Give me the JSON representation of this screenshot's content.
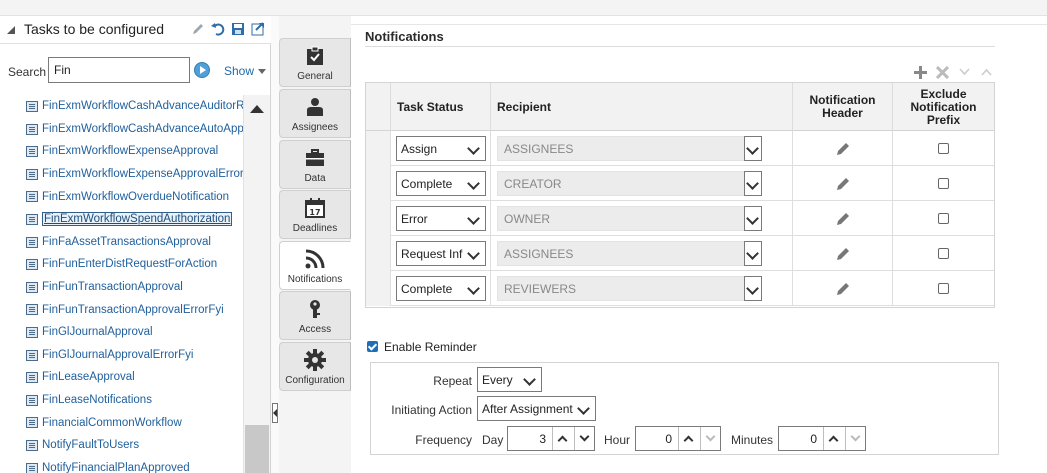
{
  "left_panel": {
    "title": "Tasks to be configured",
    "search_label": "Search",
    "search_value": "Fin",
    "show_label": "Show",
    "tasks": [
      "FinExmWorkflowCashAdvanceAuditorRej",
      "FinExmWorkflowCashAdvanceAutoApplie",
      "FinExmWorkflowExpenseApproval",
      "FinExmWorkflowExpenseApprovalErrorFy",
      "FinExmWorkflowOverdueNotification",
      "FinExmWorkflowSpendAuthorization",
      "FinFaAssetTransactionsApproval",
      "FinFunEnterDistRequestForAction",
      "FinFunTransactionApproval",
      "FinFunTransactionApprovalErrorFyi",
      "FinGlJournalApproval",
      "FinGlJournalApprovalErrorFyi",
      "FinLeaseApproval",
      "FinLeaseNotifications",
      "FinancialCommonWorkflow",
      "NotifyFaultToUsers",
      "NotifyFinancialPlanApproved"
    ],
    "selected_task": "FinExmWorkflowSpendAuthorization"
  },
  "tabs": [
    {
      "label": "General",
      "icon": "clipboard-check-icon"
    },
    {
      "label": "Assignees",
      "icon": "person-icon"
    },
    {
      "label": "Data",
      "icon": "briefcase-icon"
    },
    {
      "label": "Deadlines",
      "icon": "calendar-icon"
    },
    {
      "label": "Notifications",
      "icon": "rss-icon"
    },
    {
      "label": "Access",
      "icon": "key-icon"
    },
    {
      "label": "Configuration",
      "icon": "gear-icon"
    }
  ],
  "active_tab": "Notifications",
  "notifications": {
    "section_title": "Notifications",
    "columns": {
      "task_status": "Task Status",
      "recipient": "Recipient",
      "notification_header_1": "Notification",
      "notification_header_2": "Header",
      "exclude_1": "Exclude",
      "exclude_2": "Notification",
      "exclude_3": "Prefix"
    },
    "rows": [
      {
        "status": "Assign",
        "recipient": "ASSIGNEES"
      },
      {
        "status": "Complete",
        "recipient": "CREATOR"
      },
      {
        "status": "Error",
        "recipient": "OWNER"
      },
      {
        "status": "Request Inf",
        "recipient": "ASSIGNEES"
      },
      {
        "status": "Complete",
        "recipient": "REVIEWERS"
      }
    ]
  },
  "reminder": {
    "enable_label": "Enable Reminder",
    "enabled": true,
    "repeat_label": "Repeat",
    "repeat_value": "Every",
    "initiating_label": "Initiating Action",
    "initiating_value": "After Assignment",
    "frequency_label": "Frequency",
    "day_label": "Day",
    "day_value": "3",
    "hour_label": "Hour",
    "hour_value": "0",
    "minutes_label": "Minutes",
    "minutes_value": "0"
  },
  "colors": {
    "link": "#1f5f9c",
    "accent": "#1f6fb8",
    "header_bg": "#f2f2f2"
  }
}
